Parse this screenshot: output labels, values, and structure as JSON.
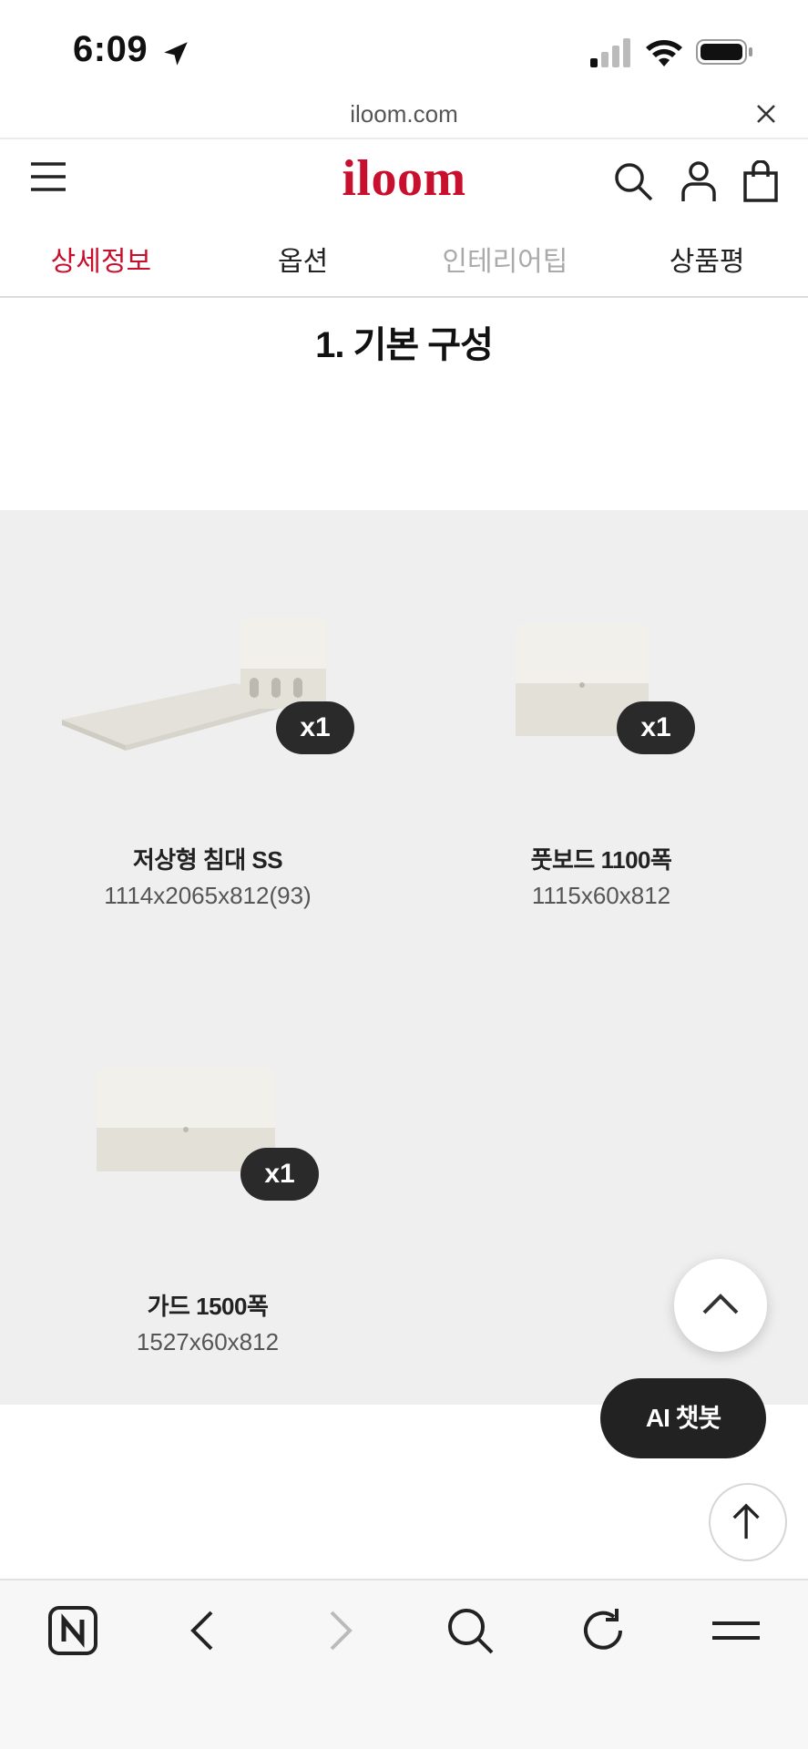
{
  "status": {
    "time": "6:09"
  },
  "browser": {
    "url": "iloom.com"
  },
  "header": {
    "logo": "iloom"
  },
  "tabs": [
    {
      "label": "상세정보",
      "state": "active"
    },
    {
      "label": "옵션",
      "state": "normal"
    },
    {
      "label": "인테리어팁",
      "state": "muted"
    },
    {
      "label": "상품평",
      "state": "normal"
    }
  ],
  "section": {
    "title": "1. 기본 구성"
  },
  "products": [
    {
      "name": "저상형 침대 SS",
      "dimensions": "1114x2065x812(93)",
      "qty": "x1"
    },
    {
      "name": "풋보드 1100폭",
      "dimensions": "1115x60x812",
      "qty": "x1"
    },
    {
      "name": "가드 1500폭",
      "dimensions": "1527x60x812",
      "qty": "x1"
    }
  ],
  "floating": {
    "ai_chat": "AI 챗봇"
  },
  "colors": {
    "brand": "#c8102e",
    "panel": "#efefef",
    "dark": "#222222"
  },
  "toolbar_icons": [
    "naver-n-icon",
    "back-icon",
    "forward-icon",
    "search-icon",
    "reload-icon",
    "menu-icon"
  ]
}
